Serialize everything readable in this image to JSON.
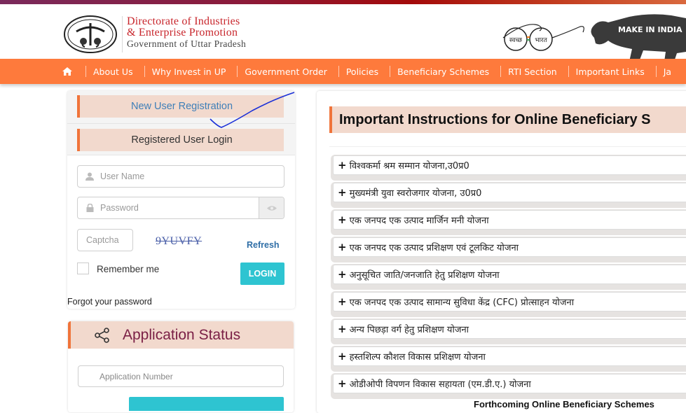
{
  "header": {
    "org_line1": "Directorate of Industries",
    "org_line2": "& Enterprise Promotion",
    "org_line3": "Government of Uttar Pradesh",
    "emblem_icon": "up-state-emblem-icon",
    "swachh_left": "स्वच्छ",
    "swachh_right": "भारत",
    "make_in_india": "MAKE IN INDIA"
  },
  "nav": {
    "home_icon": "home-icon",
    "items": [
      {
        "label": "About Us"
      },
      {
        "label": "Why Invest in UP"
      },
      {
        "label": "Government Order"
      },
      {
        "label": "Policies"
      },
      {
        "label": "Beneficiary Schemes"
      },
      {
        "label": "RTI Section"
      },
      {
        "label": "Important Links"
      },
      {
        "label": "Ja"
      }
    ]
  },
  "login": {
    "new_user_label": "New User Registration",
    "registered_label": "Registered User Login",
    "username_placeholder": "User Name",
    "password_placeholder": "Password",
    "captcha_placeholder": "Captcha",
    "captcha_text": "9YUVFY",
    "refresh_label": "Refresh",
    "remember_label": "Remember me",
    "login_label": "LOGIN",
    "forgot_label": "Forgot your password"
  },
  "status": {
    "title": "Application Status",
    "app_number_placeholder": "Application Number"
  },
  "main": {
    "title": "Important Instructions for Online Beneficiary S",
    "schemes": [
      {
        "label": "विश्वकर्मा श्रम सम्मान योजना,उ0प्र0"
      },
      {
        "label": "मुख्यमंत्री युवा स्वरोजगार योजना, उ0प्र0"
      },
      {
        "label": "एक जनपद एक उत्पाद मार्जिन मनी योजना"
      },
      {
        "label": "एक जनपद एक उत्पाद प्रशिक्षण एवं टूलकिट योजना"
      },
      {
        "label": "अनुसूचित जाति/जनजाति हेतु प्रशिक्षण योजना"
      },
      {
        "label": "एक जनपद एक उत्पाद सामान्य सुविधा केंद्र (CFC) प्रोत्साहन योजना"
      },
      {
        "label": "अन्य पिछड़ा वर्ग हेतु प्रशिक्षण योजना"
      },
      {
        "label": "हस्तशिल्प कौशल विकास प्रशिक्षण योजना"
      },
      {
        "label": "ओडीओपी विपणन विकास सहायता (एम.डी.ए.) योजना"
      }
    ],
    "plus_glyph": "+",
    "forthcoming_label": "Forthcoming Online Beneficiary Schemes"
  },
  "colors": {
    "nav_orange": "#fe7a3c",
    "accent_border": "#f0743a",
    "tab_bg": "#f2d9cd",
    "login_button": "#2ec4d1",
    "status_title": "#7a1f45",
    "org_red": "#c8262c"
  }
}
